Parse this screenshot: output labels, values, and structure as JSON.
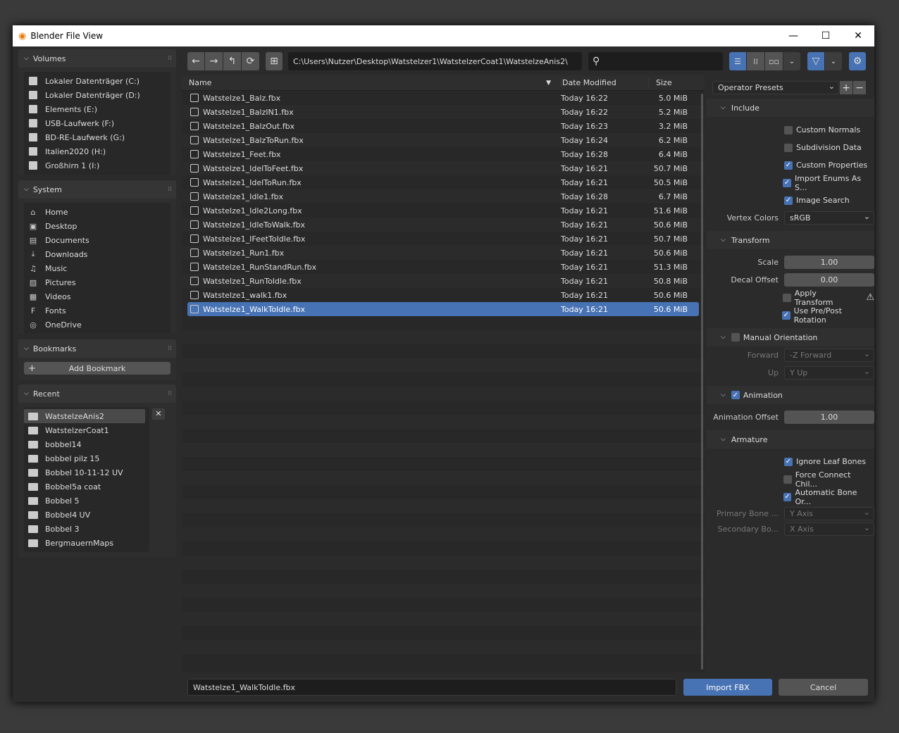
{
  "window": {
    "title": "Blender File View",
    "logo": "blender-logo",
    "min": "—",
    "max": "☐",
    "close": "✕"
  },
  "volumes": {
    "title": "Volumes",
    "items": [
      "Lokaler Datenträger (C:)",
      "Lokaler Datenträger (D:)",
      "Elements (E:)",
      "USB-Laufwerk (F:)",
      "BD-RE-Laufwerk (G:)",
      "Italien2020 (H:)",
      "Großhirn 1 (I:)"
    ]
  },
  "system": {
    "title": "System",
    "items": [
      {
        "label": "Home",
        "icon": "⌂"
      },
      {
        "label": "Desktop",
        "icon": "▣"
      },
      {
        "label": "Documents",
        "icon": "▤"
      },
      {
        "label": "Downloads",
        "icon": "⤓"
      },
      {
        "label": "Music",
        "icon": "♫"
      },
      {
        "label": "Pictures",
        "icon": "▨"
      },
      {
        "label": "Videos",
        "icon": "▦"
      },
      {
        "label": "Fonts",
        "icon": "F"
      },
      {
        "label": "OneDrive",
        "icon": "◎"
      }
    ]
  },
  "bookmarks": {
    "title": "Bookmarks",
    "add": "Add Bookmark"
  },
  "recent": {
    "title": "Recent",
    "items": [
      "WatstelzeAnis2",
      "WatstelzerCoat1",
      "bobbel14",
      "bobbel pilz 15",
      "Bobbel 10-11-12 UV",
      "Bobbel5a coat",
      "Bobbel 5",
      "Bobbel4 UV",
      "Bobbel 3",
      "BergmauernMaps"
    ]
  },
  "path": "C:\\Users\\Nutzer\\Desktop\\Watstelzer1\\WatstelzerCoat1\\WatstelzeAnis2\\",
  "search": {
    "value": "",
    "placeholder": ""
  },
  "columns": {
    "name": "Name",
    "date": "Date Modified",
    "size": "Size"
  },
  "files": [
    [
      "Watstelze1_Balz.fbx",
      "Today 16:22",
      "5.0 MiB"
    ],
    [
      "Watstelze1_BalzIN1.fbx",
      "Today 16:22",
      "5.2 MiB"
    ],
    [
      "Watstelze1_BalzOut.fbx",
      "Today 16:23",
      "3.2 MiB"
    ],
    [
      "Watstelze1_BalzToRun.fbx",
      "Today 16:24",
      "6.2 MiB"
    ],
    [
      "Watstelze1_Feet.fbx",
      "Today 16:28",
      "6.4 MiB"
    ],
    [
      "Watstelze1_IdelToFeet.fbx",
      "Today 16:21",
      "50.7 MiB"
    ],
    [
      "Watstelze1_IdelToRun.fbx",
      "Today 16:21",
      "50.5 MiB"
    ],
    [
      "Watstelze1_Idle1.fbx",
      "Today 16:28",
      "6.7 MiB"
    ],
    [
      "Watstelze1_Idle2Long.fbx",
      "Today 16:21",
      "51.6 MiB"
    ],
    [
      "Watstelze1_IdleToWalk.fbx",
      "Today 16:21",
      "50.6 MiB"
    ],
    [
      "Watstelze1_IFeetToIdle.fbx",
      "Today 16:21",
      "50.7 MiB"
    ],
    [
      "Watstelze1_Run1.fbx",
      "Today 16:21",
      "50.6 MiB"
    ],
    [
      "Watstelze1_RunStandRun.fbx",
      "Today 16:21",
      "51.3 MiB"
    ],
    [
      "Watstelze1_RunToIdle.fbx",
      "Today 16:21",
      "50.8 MiB"
    ],
    [
      "Watstelze1_walk1.fbx",
      "Today 16:21",
      "50.6 MiB"
    ],
    [
      "Watstelze1_WalkToIdle.fbx",
      "Today 16:21",
      "50.6 MiB"
    ]
  ],
  "selected_file": 15,
  "props": {
    "presets": "Operator Presets",
    "include": "Include",
    "custom_normals": "Custom Normals",
    "subdivision": "Subdivision Data",
    "custom_props": "Custom Properties",
    "enums": "Import Enums As S...",
    "image_search": "Image Search",
    "vertex_colors_label": "Vertex Colors",
    "vertex_colors": "sRGB",
    "transform": "Transform",
    "scale_label": "Scale",
    "scale": "1.00",
    "decal_label": "Decal Offset",
    "decal": "0.00",
    "apply_transform": "Apply Transform",
    "pre_post": "Use Pre/Post Rotation",
    "manual_orientation": "Manual Orientation",
    "forward_label": "Forward",
    "forward": "-Z Forward",
    "up_label": "Up",
    "up": "Y Up",
    "animation": "Animation",
    "anim_offset_label": "Animation Offset",
    "anim_offset": "1.00",
    "armature": "Armature",
    "ignore_leaf": "Ignore Leaf Bones",
    "force_connect": "Force Connect Chil...",
    "auto_bone": "Automatic Bone Or...",
    "primary_label": "Primary Bone ...",
    "primary": "Y Axis",
    "secondary_label": "Secondary Bo...",
    "secondary": "X Axis"
  },
  "filename": "Watstelze1_WalkToIdle.fbx",
  "import_label": "Import FBX",
  "cancel_label": "Cancel",
  "colors": {
    "accent": "#4772b3",
    "bg": "#2b2b2b"
  }
}
